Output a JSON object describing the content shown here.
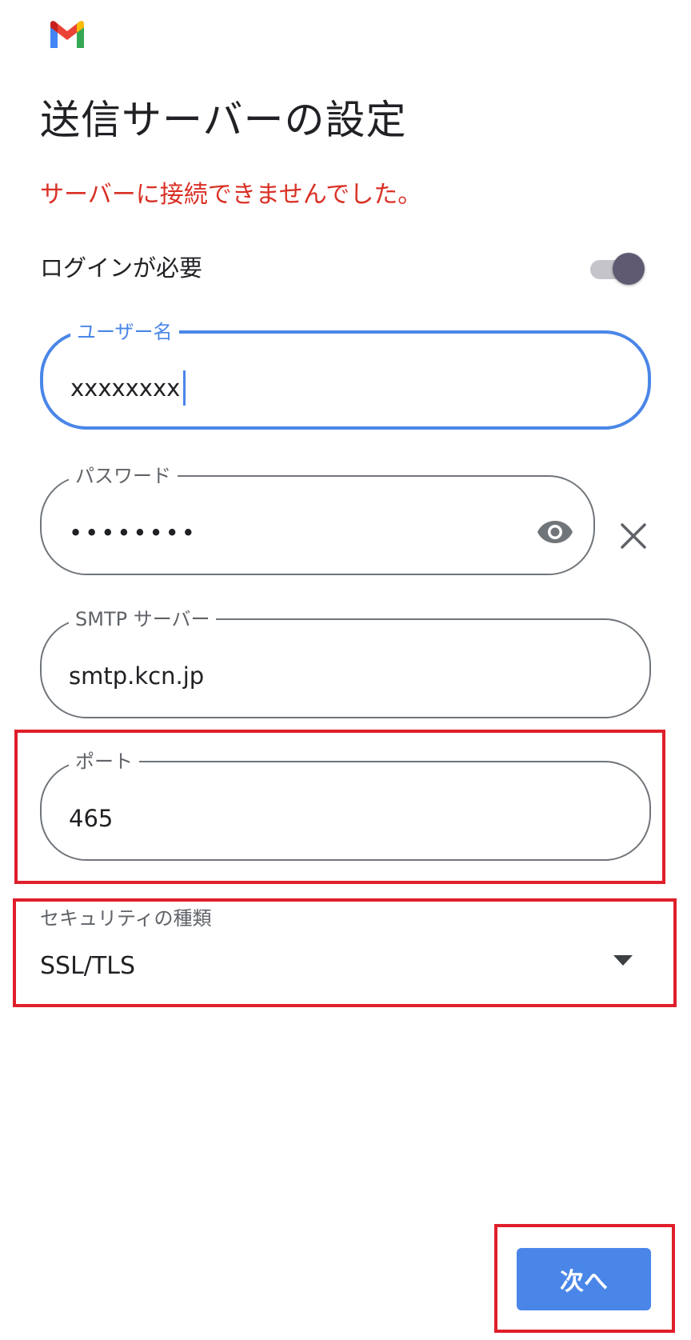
{
  "header": {
    "logo_icon": "gmail-logo-icon"
  },
  "title": "送信サーバーの設定",
  "error_message": "サーバーに接続できませんでした。",
  "login_required": {
    "label": "ログインが必要",
    "enabled": true
  },
  "fields": {
    "username": {
      "label": "ユーザー名",
      "value": "xxxxxxxx"
    },
    "password": {
      "label": "パスワード",
      "value": "••••••••"
    },
    "smtp_server": {
      "label": "SMTP サーバー",
      "value": "smtp.kcn.jp"
    },
    "port": {
      "label": "ポート",
      "value": "465"
    }
  },
  "security": {
    "label": "セキュリティの種類",
    "value": "SSL/TLS"
  },
  "next_button": {
    "label": "次へ"
  },
  "colors": {
    "accent": "#4a86e8",
    "error": "#d93025",
    "highlight": "#e01e2b"
  }
}
